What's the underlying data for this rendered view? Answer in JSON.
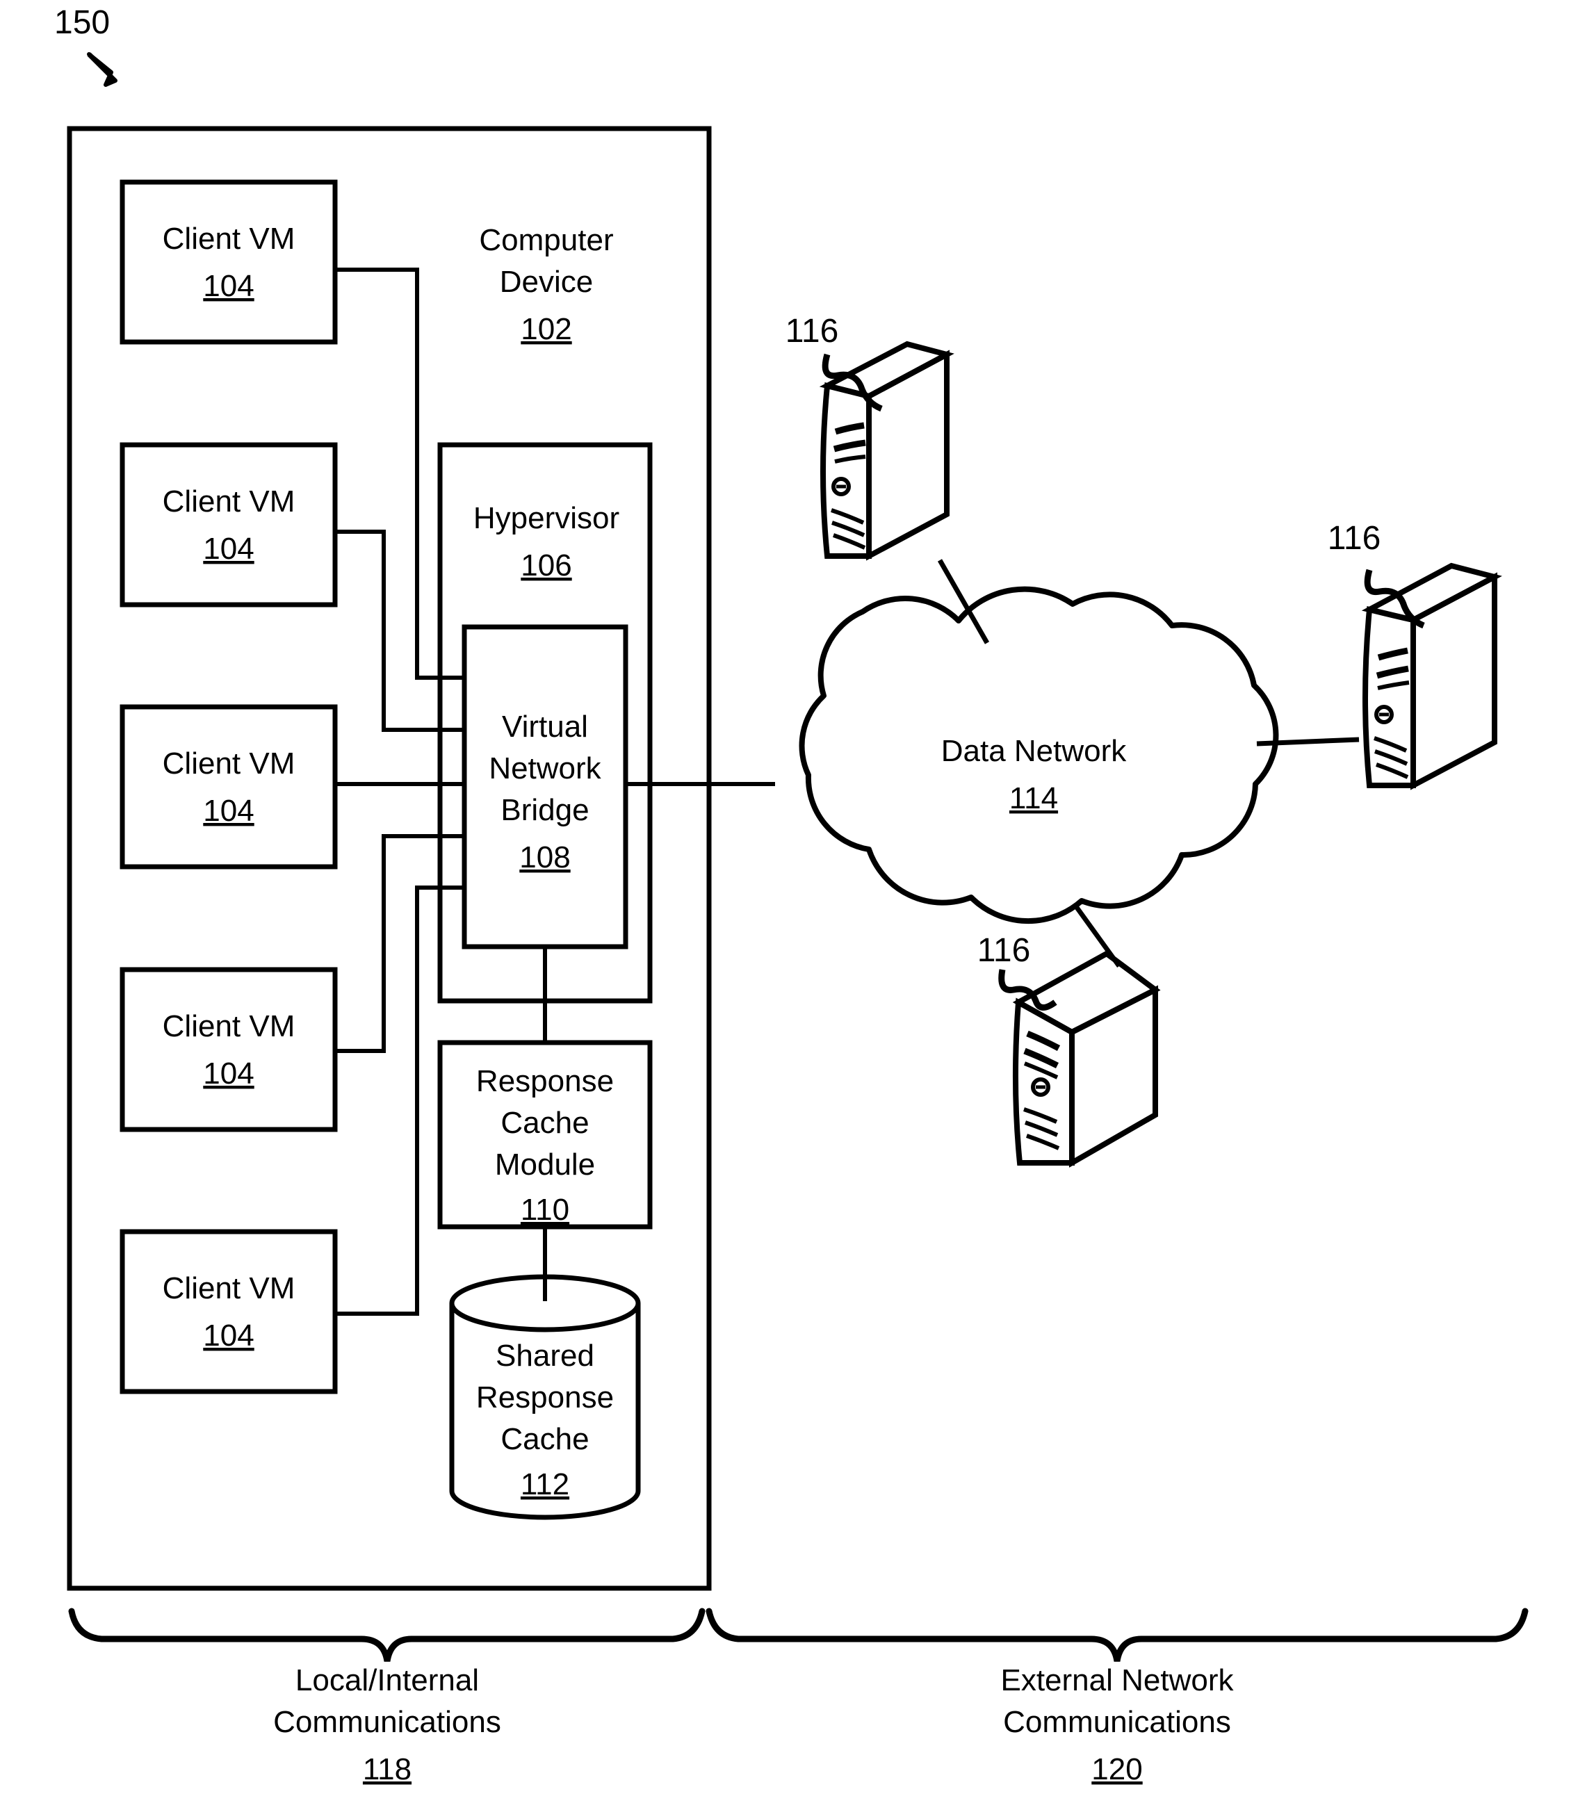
{
  "figure": {
    "figure_number": "150",
    "arrow_icon": "diagonal-arrow-icon"
  },
  "computer_device": {
    "title_line1": "Computer",
    "title_line2": "Device",
    "ref": "102"
  },
  "client_vms": [
    {
      "label": "Client VM",
      "ref": "104"
    },
    {
      "label": "Client VM",
      "ref": "104"
    },
    {
      "label": "Client VM",
      "ref": "104"
    },
    {
      "label": "Client VM",
      "ref": "104"
    },
    {
      "label": "Client VM",
      "ref": "104"
    }
  ],
  "hypervisor": {
    "label": "Hypervisor",
    "ref": "106"
  },
  "virtual_network_bridge": {
    "line1": "Virtual",
    "line2": "Network",
    "line3": "Bridge",
    "ref": "108"
  },
  "response_cache_module": {
    "line1": "Response",
    "line2": "Cache",
    "line3": "Module",
    "ref": "110"
  },
  "shared_response_cache": {
    "line1": "Shared",
    "line2": "Response",
    "line3": "Cache",
    "ref": "112"
  },
  "data_network": {
    "label": "Data Network",
    "ref": "114"
  },
  "servers": [
    {
      "ref": "116",
      "position": "top"
    },
    {
      "ref": "116",
      "position": "right"
    },
    {
      "ref": "116",
      "position": "bottom"
    }
  ],
  "brackets": {
    "local": {
      "line1": "Local/Internal",
      "line2": "Communications",
      "ref": "118"
    },
    "external": {
      "line1": "External Network",
      "line2": "Communications",
      "ref": "120"
    }
  },
  "colors": {
    "ink": "#000000",
    "paper": "#ffffff"
  }
}
